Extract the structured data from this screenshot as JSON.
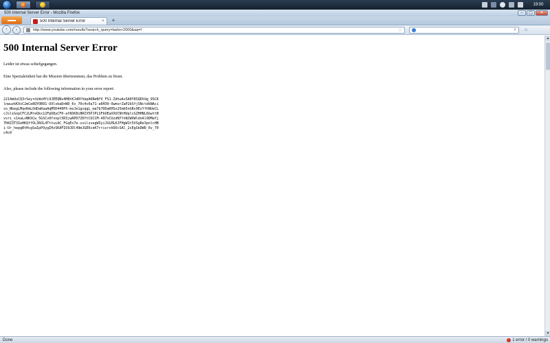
{
  "taskbar": {
    "clock": "19:00"
  },
  "window": {
    "title": "500 Internal Server Error - Mozilla Firefox",
    "min": "–",
    "max": "▢",
    "close": "✕"
  },
  "tabs": [
    {
      "label": "500 Internal Server Error",
      "close": "×"
    }
  ],
  "new_tab": "+",
  "nav": {
    "url": "http://www.youtube.com/results?search_query=bahn+2000&aq=f",
    "back": "‹",
    "forward": "›",
    "star": "☆",
    "search_go": "⌕",
    "home": "⌂"
  },
  "page": {
    "heading": "500 Internal Server Error",
    "p1": "Leider ist etwas schiefgegangen.",
    "p2": "Eine Spezialeinheit hat die Mission übernommen, das Problem zu lösen.",
    "p3": "Also, please include the following information in your error report:",
    "dump": "2214mUuCQ3rSeyrdiWsHYi9JEEQNv4HBtKJdRfhbpA6NeNfV_FS1-ZdhuAvSA0Y8SQDVdg_9SCKlnwuzkKXvC2mCe8QYOB91-OXlvbaDnWD_6v_70c4c0a71-a6H30-OwmvrZaP2bSfjSNctdkNAciso_NbegLMqoKmLOdDaRaaAqM5D449PX-moJe1gsqgL_ma7b7DDaKHSo25mb5nGRs9EsYfhNUeCLcJsliGopCFC2LMreQkx12FpD8yCF0-atNSK8iNRIV5PJPLSFbOEaXXUCNtHUplcGZHHNL6bwttBvsri_s1kaLxNKXCw_5GSCv0fvnpl5R3jwRPD7Z6YtCUCCM-497oCUzdN7fnNJWXWldnAl9DMaYj7H4Z3T3IeHKQffOL36OL4TttuiAC_FGqEx7e-sxilzsegWIyiJULMLKJFHgW1t5VSgRe3pnlcHBi-Ur_hepgBtHcgSaIpPOygIHzSKAFIO9JDl49mJGE6ceK7rrisrxhDOcSAl_2sEgSkDWD_6v_70c4c0"
  }
}
